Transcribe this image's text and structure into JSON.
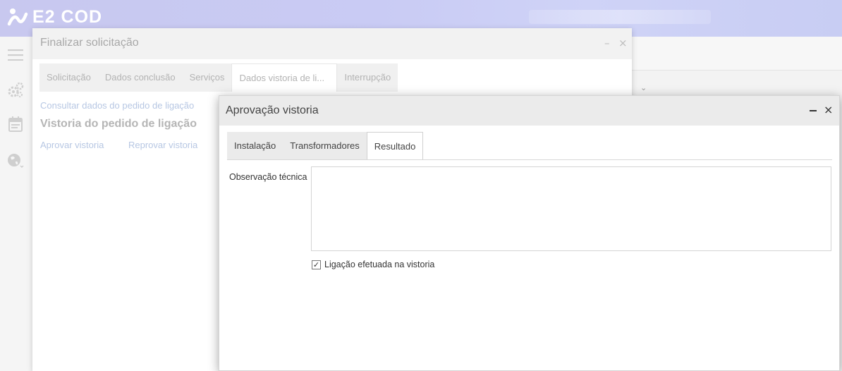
{
  "app": {
    "logo_text": "E2 COD"
  },
  "colors": {
    "accent_header": "#c9cbf4",
    "link": "#b7c7e3"
  },
  "icons": [
    "hamburger-menu-icon",
    "gears-icon",
    "calendar-icon",
    "globe-icon",
    "logo-icon",
    "chevron-down-icon",
    "close-icon",
    "minimize-icon",
    "check-icon"
  ],
  "finalizar_dialog": {
    "title": "Finalizar solicitação",
    "minimize_glyph": "–",
    "close_glyph": "×",
    "tabs": [
      {
        "label": "Solicitação",
        "active": false
      },
      {
        "label": "Dados conclusão",
        "active": false
      },
      {
        "label": "Serviços",
        "active": false
      },
      {
        "label": "Dados vistoria de li...",
        "active": true
      },
      {
        "label": "Interrupção",
        "active": false
      }
    ],
    "consult_link": "Consultar dados do pedido de ligação",
    "section_title": "Vistoria do pedido de ligação",
    "approve_link": "Aprovar vistoria",
    "reject_link": "Reprovar vistoria"
  },
  "aprovacao_dialog": {
    "title": "Aprovação vistoria",
    "close_glyph": "×",
    "tabs": [
      {
        "label": "Instalação",
        "active": false
      },
      {
        "label": "Transformadores",
        "active": false
      },
      {
        "label": "Resultado",
        "active": true
      }
    ],
    "obs_label": "Observação técnica",
    "obs_value": "",
    "checkbox_label": "Ligação efetuada na vistoria",
    "checkbox_checked": true,
    "check_glyph": "✓"
  }
}
